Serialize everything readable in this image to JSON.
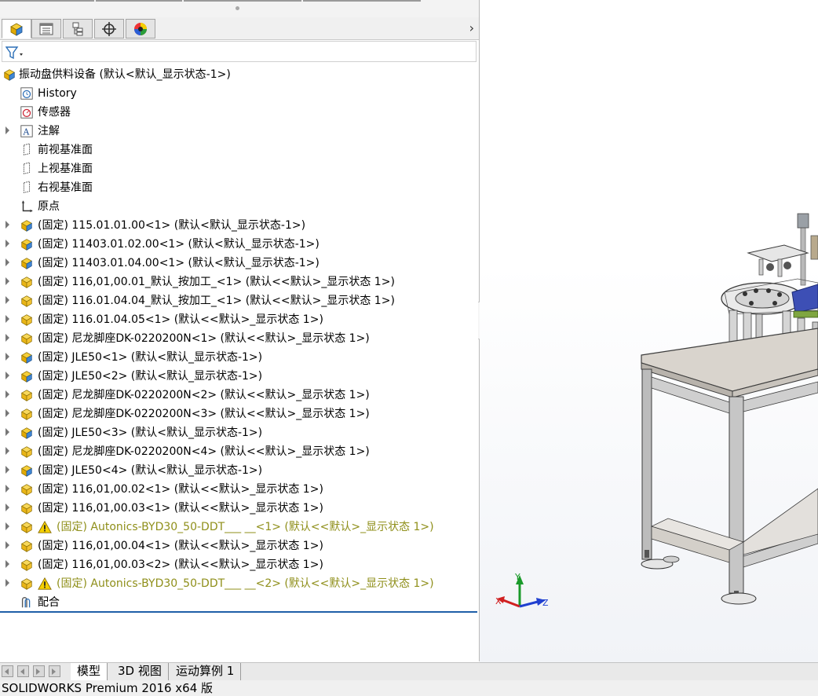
{
  "feature_tree": {
    "root": {
      "label": "振动盘供料设备  (默认<默认_显示状态-1>)",
      "icon": "assembly-icon"
    },
    "items": [
      {
        "label": "History",
        "icon": "history-icon",
        "expandable": false,
        "warning": false
      },
      {
        "label": "传感器",
        "icon": "sensor-icon",
        "expandable": false,
        "warning": false
      },
      {
        "label": "注解",
        "icon": "annotation-icon",
        "expandable": true,
        "warning": false
      },
      {
        "label": "前视基准面",
        "icon": "plane-icon",
        "expandable": false,
        "warning": false
      },
      {
        "label": "上视基准面",
        "icon": "plane-icon",
        "expandable": false,
        "warning": false
      },
      {
        "label": "右视基准面",
        "icon": "plane-icon",
        "expandable": false,
        "warning": false
      },
      {
        "label": "原点",
        "icon": "origin-icon",
        "expandable": false,
        "warning": false
      },
      {
        "label": "(固定) 115.01.01.00<1> (默认<默认_显示状态-1>)",
        "icon": "subassembly-icon",
        "expandable": true,
        "warning": false
      },
      {
        "label": "(固定) 11403.01.02.00<1> (默认<默认_显示状态-1>)",
        "icon": "subassembly-icon",
        "expandable": true,
        "warning": false
      },
      {
        "label": "(固定) 11403.01.04.00<1> (默认<默认_显示状态-1>)",
        "icon": "subassembly-icon",
        "expandable": true,
        "warning": false
      },
      {
        "label": "(固定) 116,01,00.01_默认_按加工_<1> (默认<<默认>_显示状态 1>)",
        "icon": "part-icon",
        "expandable": true,
        "warning": false
      },
      {
        "label": "(固定) 116.01.04.04_默认_按加工_<1> (默认<<默认>_显示状态 1>)",
        "icon": "part-icon",
        "expandable": true,
        "warning": false
      },
      {
        "label": "(固定) 116.01.04.05<1> (默认<<默认>_显示状态 1>)",
        "icon": "part-icon",
        "expandable": true,
        "warning": false
      },
      {
        "label": "(固定) 尼龙脚座DK-0220200N<1> (默认<<默认>_显示状态 1>)",
        "icon": "part-icon",
        "expandable": true,
        "warning": false
      },
      {
        "label": "(固定) JLE50<1> (默认<默认_显示状态-1>)",
        "icon": "subassembly-icon",
        "expandable": true,
        "warning": false
      },
      {
        "label": "(固定) JLE50<2> (默认<默认_显示状态-1>)",
        "icon": "subassembly-icon",
        "expandable": true,
        "warning": false
      },
      {
        "label": "(固定) 尼龙脚座DK-0220200N<2> (默认<<默认>_显示状态 1>)",
        "icon": "part-icon",
        "expandable": true,
        "warning": false
      },
      {
        "label": "(固定) 尼龙脚座DK-0220200N<3> (默认<<默认>_显示状态 1>)",
        "icon": "part-icon",
        "expandable": true,
        "warning": false
      },
      {
        "label": "(固定) JLE50<3> (默认<默认_显示状态-1>)",
        "icon": "subassembly-icon",
        "expandable": true,
        "warning": false
      },
      {
        "label": "(固定) 尼龙脚座DK-0220200N<4> (默认<<默认>_显示状态 1>)",
        "icon": "part-icon",
        "expandable": true,
        "warning": false
      },
      {
        "label": "(固定) JLE50<4> (默认<默认_显示状态-1>)",
        "icon": "subassembly-icon",
        "expandable": true,
        "warning": false
      },
      {
        "label": "(固定) 116,01,00.02<1> (默认<<默认>_显示状态 1>)",
        "icon": "part-icon",
        "expandable": true,
        "warning": false
      },
      {
        "label": "(固定) 116,01,00.03<1> (默认<<默认>_显示状态 1>)",
        "icon": "part-icon",
        "expandable": true,
        "warning": false
      },
      {
        "label": "(固定) Autonics-BYD30_50-DDT___ __<1> (默认<<默认>_显示状态 1>)",
        "icon": "part-icon",
        "expandable": true,
        "warning": true
      },
      {
        "label": "(固定) 116,01,00.04<1> (默认<<默认>_显示状态 1>)",
        "icon": "part-icon",
        "expandable": true,
        "warning": false
      },
      {
        "label": "(固定) 116,01,00.03<2> (默认<<默认>_显示状态 1>)",
        "icon": "part-icon",
        "expandable": true,
        "warning": false
      },
      {
        "label": "(固定) Autonics-BYD30_50-DDT___ __<2> (默认<<默认>_显示状态 1>)",
        "icon": "part-icon",
        "expandable": true,
        "warning": true
      },
      {
        "label": "配合",
        "icon": "mates-icon",
        "expandable": false,
        "warning": false
      }
    ]
  },
  "panel_tabs": [
    {
      "name": "feature-manager-tab",
      "active": true
    },
    {
      "name": "property-manager-tab",
      "active": false
    },
    {
      "name": "configuration-manager-tab",
      "active": false
    },
    {
      "name": "dimxpert-manager-tab",
      "active": false
    },
    {
      "name": "display-manager-tab",
      "active": false
    }
  ],
  "triad": {
    "x": "X",
    "y": "Y",
    "z": "Z"
  },
  "bottom_tabs": [
    "模型",
    "3D 视图",
    "运动算例 1"
  ],
  "status_bar": {
    "text": "SOLIDWORKS Premium 2016 x64 版"
  },
  "colors": {
    "warning_text": "#8f8f1a",
    "accent_line": "#1f5fa8",
    "part_yellow": "#f2c230",
    "assembly_blue": "#4d93d9"
  }
}
